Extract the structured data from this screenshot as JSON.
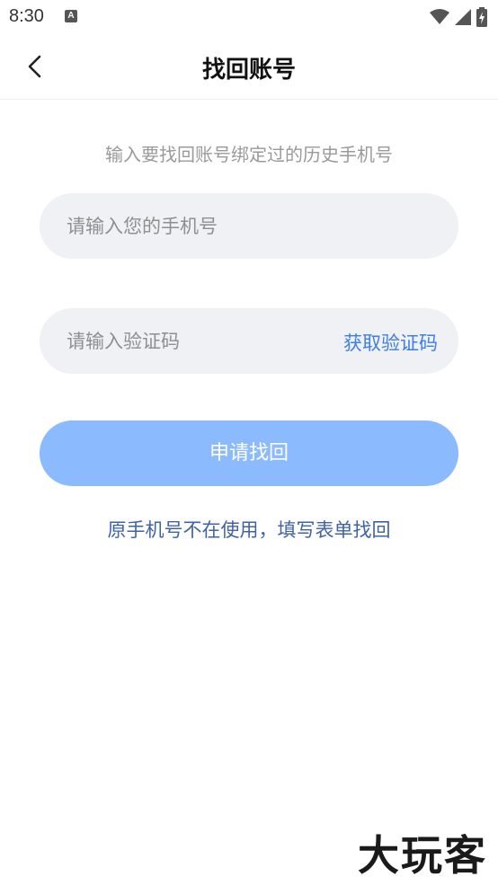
{
  "status_bar": {
    "time": "8:30",
    "notification_icon": "a-notification-icon",
    "a_label": "A",
    "wifi_icon": "wifi-icon",
    "signal_icon": "cell-signal-icon",
    "battery_icon": "battery-charging-icon"
  },
  "nav": {
    "title": "找回账号",
    "back_icon": "chevron-left-icon"
  },
  "form": {
    "hint": "输入要找回账号绑定过的历史手机号",
    "phone_placeholder": "请输入您的手机号",
    "phone_value": "",
    "code_placeholder": "请输入验证码",
    "code_value": "",
    "get_code_label": "获取验证码",
    "submit_label": "申请找回",
    "alt_link_label": "原手机号不在使用，填写表单找回"
  },
  "colors": {
    "accent": "#3d7ee8",
    "button_disabled": "#8cbaff",
    "input_bg": "#f0f1f4",
    "link": "#3f63a8"
  },
  "watermark": {
    "text": "大玩客"
  }
}
